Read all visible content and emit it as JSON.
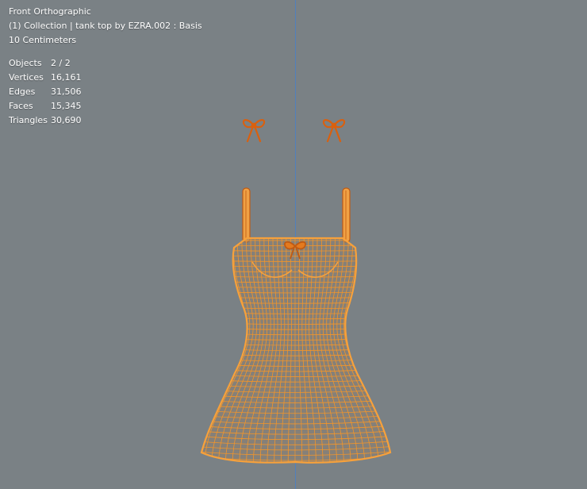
{
  "viewport": {
    "view_name": "Front Orthographic",
    "collection_line": "(1) Collection | tank top by EZRA.002 : Basis",
    "scale_line": "10 Centimeters"
  },
  "stats": [
    {
      "label": "Objects",
      "value": "2 / 2"
    },
    {
      "label": "Vertices",
      "value": "16,161"
    },
    {
      "label": "Edges",
      "value": "31,506"
    },
    {
      "label": "Faces",
      "value": "15,345"
    },
    {
      "label": "Triangles",
      "value": "30,690"
    }
  ],
  "colors": {
    "background": "#7a8185",
    "wire": "#e88a24",
    "wire_dark": "#c05a12",
    "fill": "#f0a145",
    "axis": "#4d7fc2",
    "text": "#ffffff"
  }
}
